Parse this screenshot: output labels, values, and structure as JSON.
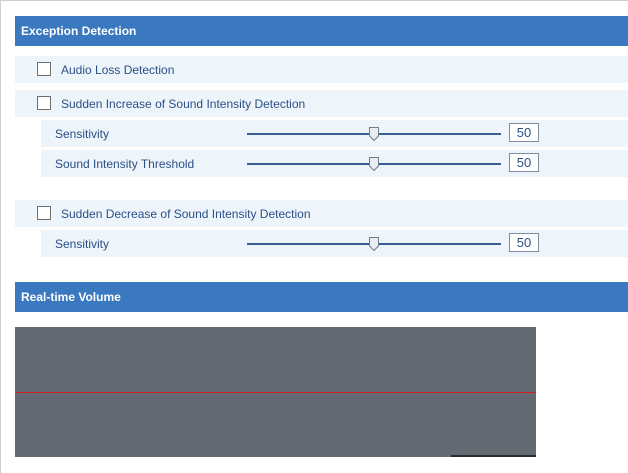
{
  "exception_detection": {
    "title": "Exception Detection",
    "audio_loss": {
      "label": "Audio Loss Detection",
      "checked": false
    },
    "sudden_increase": {
      "label": "Sudden Increase of Sound Intensity Detection",
      "checked": false,
      "sensitivity": {
        "label": "Sensitivity",
        "value": "50"
      },
      "threshold": {
        "label": "Sound Intensity Threshold",
        "value": "50"
      }
    },
    "sudden_decrease": {
      "label": "Sudden Decrease of Sound Intensity Detection",
      "checked": false,
      "sensitivity": {
        "label": "Sensitivity",
        "value": "50"
      }
    }
  },
  "realtime_volume": {
    "title": "Real-time Volume",
    "level_percent": 50
  },
  "colors": {
    "header_bg": "#3a78c0",
    "row_bg": "#edf4fa",
    "text": "#2a4f87",
    "volume_bg": "#646a74",
    "volume_line": "#d21f1f"
  }
}
